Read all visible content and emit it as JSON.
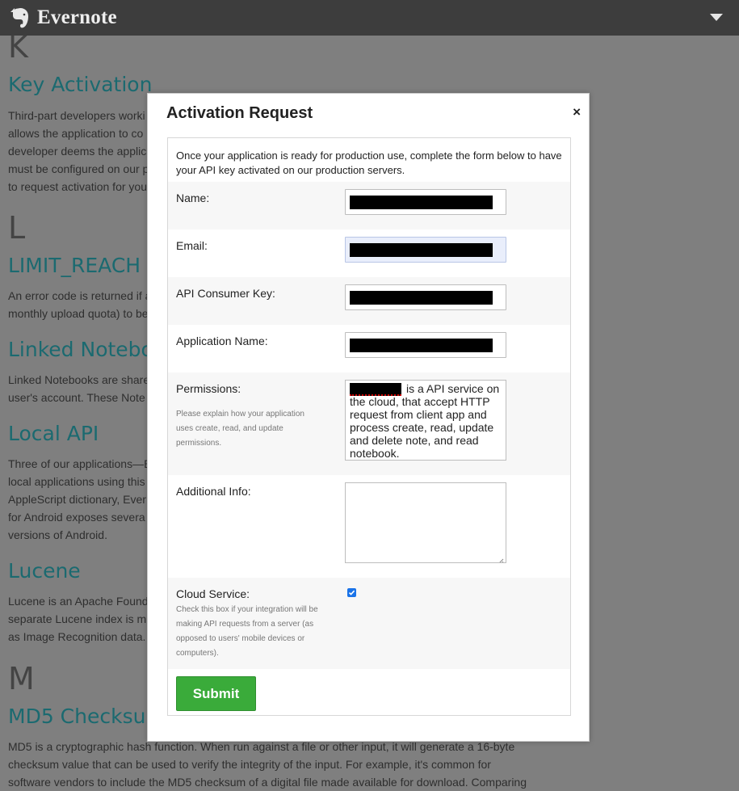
{
  "app": {
    "name": "Evernote",
    "icons": {
      "logo": "elephant-logo-icon",
      "menu": "chevron-down-icon"
    }
  },
  "background": {
    "sections": [
      {
        "letter": "K",
        "term": "Key Activation",
        "lines": [
          "Third-part developers worki",
          "allows the application to co",
          "developer deems the applic",
          "must be configured on our p",
          "to request activation for you"
        ]
      },
      {
        "letter": "L",
        "term": "LIMIT_REACH",
        "lines": [
          "An error code is returned if a",
          "monthly upload quota) to be"
        ]
      },
      {
        "term": "Linked Notebo",
        "lines": [
          "Linked Notebooks are share",
          "user's account. These Note"
        ]
      },
      {
        "term": "Local API",
        "lines": [
          "Three of our applications—E",
          "local applications using this",
          "AppleScript dictionary, Ever",
          "for Android exposes severa",
          "versions of Android."
        ]
      },
      {
        "term": "Lucene",
        "lines": [
          "Lucene is an Apache Found",
          "separate Lucene index is m",
          "as Image Recognition data."
        ]
      },
      {
        "letter": "M",
        "term": "MD5 Checksu",
        "lines": [
          "MD5 is a cryptographic hash function. When run against a file or other input, it will generate a 16-byte",
          "checksum value that can be used to verify the integrity of the input. For example, it's common for",
          "software vendors to include the MD5 checksum of a digital file made available for download. Comparing"
        ]
      }
    ]
  },
  "modal": {
    "title": "Activation Request",
    "close_label": "×",
    "intro": "Once your application is ready for production use, complete the form below to have your API key activated on our production servers.",
    "fields": {
      "name": {
        "label": "Name:",
        "value": ""
      },
      "email": {
        "label": "Email:",
        "value": ""
      },
      "consumer_key": {
        "label": "API Consumer Key:",
        "value": ""
      },
      "app_name": {
        "label": "Application Name:",
        "value": ""
      },
      "permissions": {
        "label": "Permissions:",
        "help": "Please explain how your application uses create, read, and update permissions.",
        "value": "is a API service on the cloud, that accept HTTP request from client app and process create, read, update and delete note, and read notebook."
      },
      "additional_info": {
        "label": "Additional Info:",
        "value": ""
      },
      "cloud_service": {
        "label": "Cloud Service:",
        "help": "Check this box if your integration will be making API requests from a server (as opposed to users' mobile devices or computers).",
        "checked": true
      }
    },
    "submit_label": "Submit",
    "colors": {
      "submit": "#3aab3a",
      "checkbox": "#1a73e8",
      "term_link": "#1b6a70"
    }
  }
}
